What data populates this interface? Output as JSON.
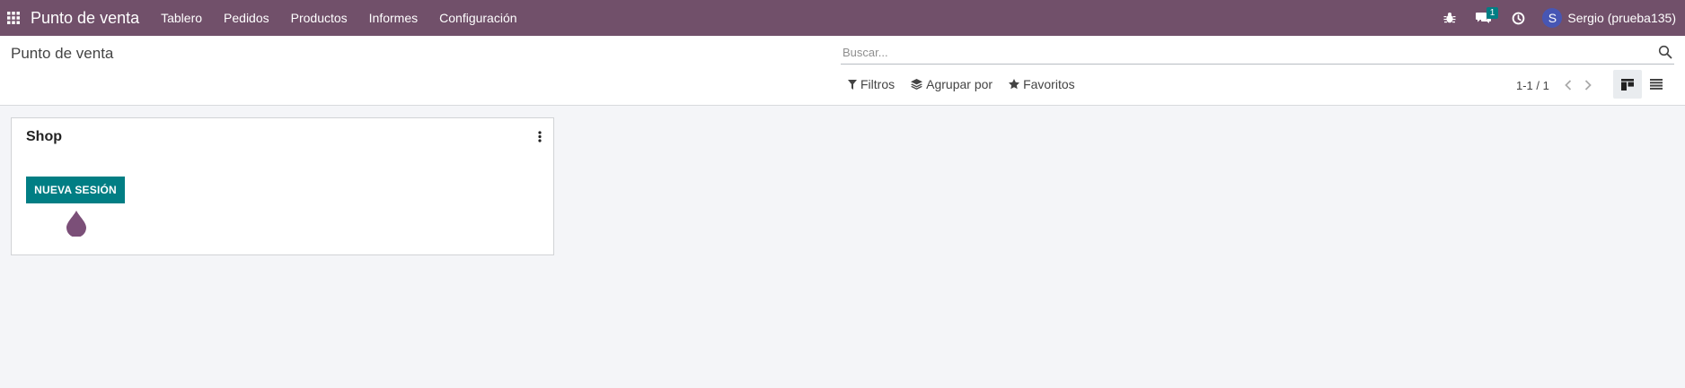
{
  "navbar": {
    "app_name": "Punto de venta",
    "menu": [
      "Tablero",
      "Pedidos",
      "Productos",
      "Informes",
      "Configuración"
    ],
    "messages_badge": "1",
    "user_initial": "S",
    "user_name": "Sergio (prueba135)",
    "icons": [
      "apps-grid-icon",
      "bug-icon",
      "chat-icon",
      "clock-icon"
    ]
  },
  "control_panel": {
    "title": "Punto de venta",
    "search_placeholder": "Buscar...",
    "filters": {
      "filter_label": "Filtros",
      "group_label": "Agrupar por",
      "favorites_label": "Favoritos"
    },
    "pager": "1-1 / 1"
  },
  "cards": [
    {
      "title": "Shop",
      "button_label": "NUEVA SESIÓN"
    }
  ],
  "colors": {
    "navbar": "#71506a",
    "primary": "#017e84",
    "avatar": "#4756b4",
    "background": "#f4f5f8"
  }
}
